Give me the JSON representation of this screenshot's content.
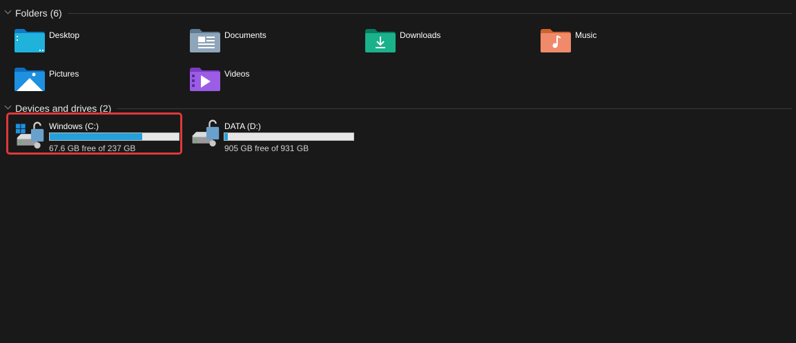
{
  "sections": {
    "folders": {
      "title": "Folders (6)",
      "items": [
        {
          "label": "Desktop",
          "icon": "desktop-folder-icon"
        },
        {
          "label": "Documents",
          "icon": "documents-folder-icon"
        },
        {
          "label": "Downloads",
          "icon": "downloads-folder-icon"
        },
        {
          "label": "Music",
          "icon": "music-folder-icon"
        },
        {
          "label": "Pictures",
          "icon": "pictures-folder-icon"
        },
        {
          "label": "Videos",
          "icon": "videos-folder-icon"
        }
      ]
    },
    "drives": {
      "title": "Devices and drives (2)",
      "items": [
        {
          "name": "Windows (C:)",
          "free_text": "67.6 GB free of 237 GB",
          "used_fraction": 0.715,
          "selected": true
        },
        {
          "name": "DATA (D:)",
          "free_text": "905 GB free of 931 GB",
          "used_fraction": 0.028,
          "selected": false
        }
      ]
    }
  },
  "colors": {
    "background": "#191919",
    "bar_fill": "#26a0da",
    "highlight": "#e0383b"
  }
}
